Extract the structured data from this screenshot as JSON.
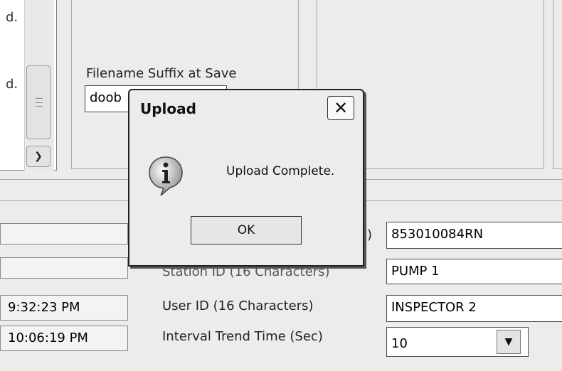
{
  "list": {
    "items": [
      "d.",
      "d."
    ]
  },
  "scroll_icons": {
    "down": "chevron-down-icon",
    "grip": "grip-icon"
  },
  "file_group": {
    "label": "Filename Suffix at Save",
    "value": "doob"
  },
  "timestamps": [
    "",
    "",
    "9:32:23 PM",
    "10:06:19 PM"
  ],
  "fields": {
    "serial_label": ")",
    "serial_value": "853010084RN",
    "station_label": "Station ID (16 Characters)",
    "station_value": "PUMP 1",
    "user_label": "User ID (16 Characters)",
    "user_value": "INSPECTOR 2",
    "interval_label": "Interval Trend Time (Sec)",
    "interval_value": "10"
  },
  "dialog": {
    "title": "Upload",
    "message": "Upload Complete.",
    "ok_label": "OK",
    "icon": "info-icon",
    "close_icon": "close-icon"
  }
}
